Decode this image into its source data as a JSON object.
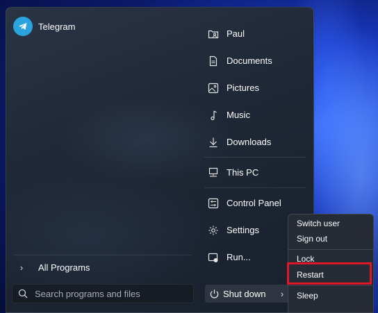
{
  "pinned": [
    {
      "label": "Telegram",
      "icon": "telegram-icon"
    }
  ],
  "places": [
    {
      "label": "Paul",
      "icon": "user-folder-icon"
    },
    {
      "label": "Documents",
      "icon": "document-icon"
    },
    {
      "label": "Pictures",
      "icon": "picture-icon"
    },
    {
      "label": "Music",
      "icon": "music-note-icon"
    },
    {
      "label": "Downloads",
      "icon": "download-icon"
    },
    {
      "label": "This PC",
      "icon": "computer-icon"
    },
    {
      "label": "Control Panel",
      "icon": "control-panel-icon"
    },
    {
      "label": "Settings",
      "icon": "gear-icon"
    },
    {
      "label": "Run...",
      "icon": "run-icon"
    }
  ],
  "all_programs": "All Programs",
  "search": {
    "placeholder": "Search programs and files"
  },
  "shutdown": {
    "label": "Shut down"
  },
  "power_menu": [
    {
      "label": "Switch user"
    },
    {
      "label": "Sign out"
    },
    {
      "label": "Lock"
    },
    {
      "label": "Restart"
    },
    {
      "label": "Sleep"
    }
  ],
  "colors": {
    "highlight": "#e0162b",
    "telegram": "#2aa3df"
  }
}
